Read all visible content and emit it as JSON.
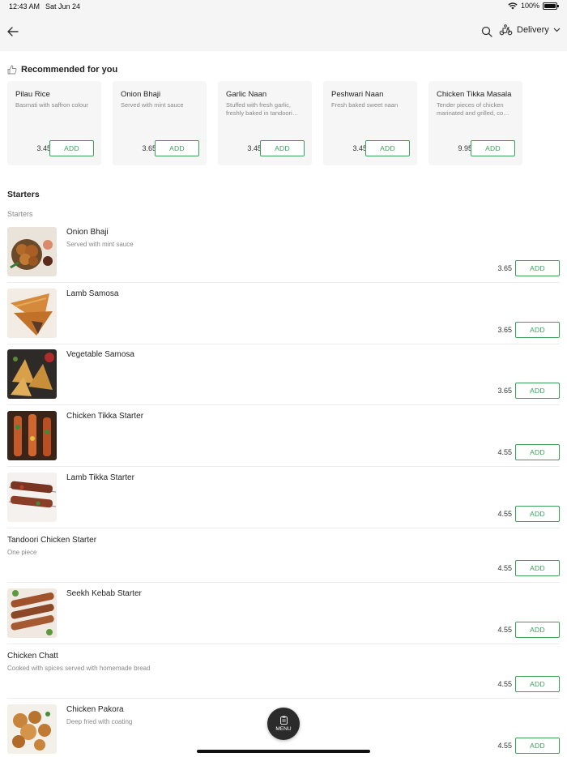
{
  "status_bar": {
    "time": "12:43 AM",
    "date": "Sat Jun 24",
    "battery": "100%"
  },
  "header": {
    "delivery_label": "Delivery",
    "icons": [
      "back-arrow-icon",
      "search-icon",
      "scooter-icon",
      "chevron-down-icon"
    ]
  },
  "recommended": {
    "title": "Recommended for you",
    "items": [
      {
        "name": "Pilau Rice",
        "desc": "Basmati with saffron colour",
        "price": "3.45",
        "add": "ADD"
      },
      {
        "name": "Onion Bhaji",
        "desc": "Served with mint sauce",
        "price": "3.65",
        "add": "ADD"
      },
      {
        "name": "Garlic Naan",
        "desc": "Stuffed with fresh garlic, freshly baked in tandoori…",
        "price": "3.45",
        "add": "ADD"
      },
      {
        "name": "Peshwari Naan",
        "desc": "Fresh baked sweet naan",
        "price": "3.45",
        "add": "ADD"
      },
      {
        "name": "Chicken Tikka Masala",
        "desc": "Tender pieces of chicken marinated and grilled, co…",
        "price": "9.95",
        "add": "ADD"
      }
    ]
  },
  "section": {
    "title": "Starters",
    "subtitle": "Starters",
    "items": [
      {
        "name": "Onion Bhaji",
        "desc": "Served with mint sauce",
        "price": "3.65",
        "add": "ADD",
        "has_image": true
      },
      {
        "name": "Lamb Samosa",
        "desc": "",
        "price": "3.65",
        "add": "ADD",
        "has_image": true
      },
      {
        "name": "Vegetable Samosa",
        "desc": "",
        "price": "3.65",
        "add": "ADD",
        "has_image": true
      },
      {
        "name": "Chicken Tikka Starter",
        "desc": "",
        "price": "4.55",
        "add": "ADD",
        "has_image": true
      },
      {
        "name": "Lamb Tikka Starter",
        "desc": "",
        "price": "4.55",
        "add": "ADD",
        "has_image": true
      },
      {
        "name": "Tandoori Chicken Starter",
        "desc": "One piece",
        "price": "4.55",
        "add": "ADD",
        "has_image": false
      },
      {
        "name": "Seekh Kebab Starter",
        "desc": "",
        "price": "4.55",
        "add": "ADD",
        "has_image": true
      },
      {
        "name": "Chicken Chatt",
        "desc": "Cooked with spices served with homemade bread",
        "price": "4.55",
        "add": "ADD",
        "has_image": false
      },
      {
        "name": "Chicken Pakora",
        "desc": "Deep fried with coating",
        "price": "4.55",
        "add": "ADD",
        "has_image": true
      }
    ]
  },
  "fab": {
    "label": "MENU"
  },
  "colors": {
    "accent": "#3aa05a",
    "header_bg": "#f5f5f5",
    "card_bg": "#f6f6f6",
    "fab_bg": "#2b2b2b"
  }
}
